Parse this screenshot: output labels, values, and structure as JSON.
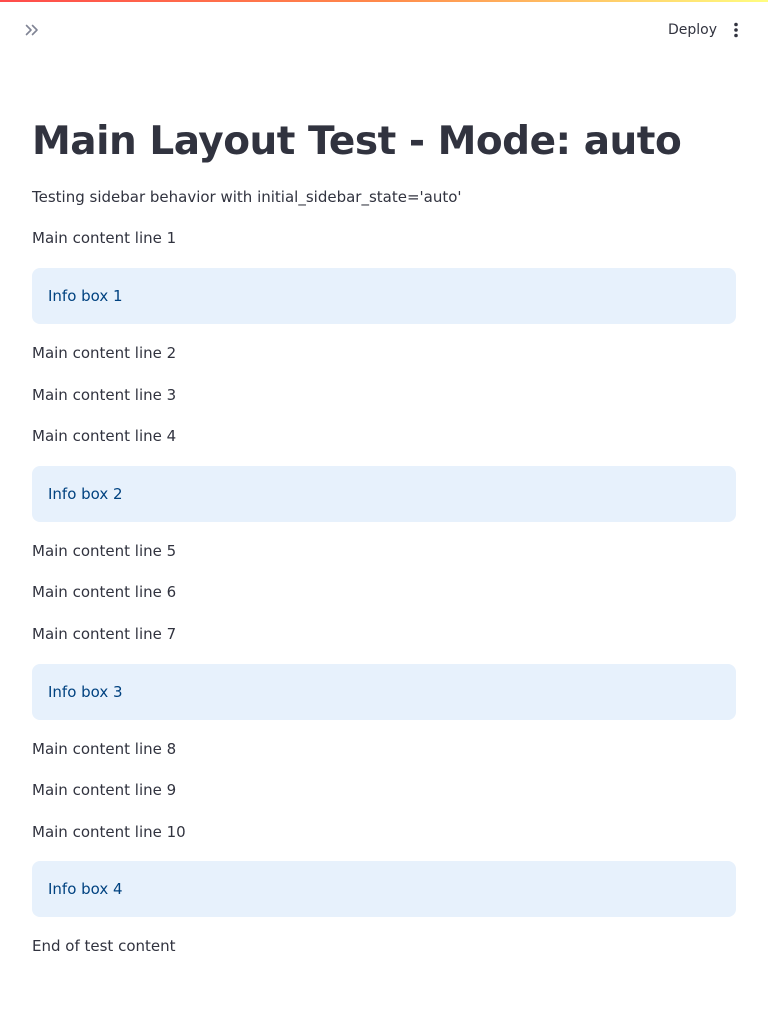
{
  "header": {
    "deploy_label": "Deploy",
    "expand_icon": "double-chevron-right-icon",
    "menu_icon": "vertical-ellipsis-icon"
  },
  "main": {
    "title": "Main Layout Test - Mode: auto",
    "subtitle": "Testing sidebar behavior with initial_sidebar_state='auto'",
    "lines": [
      "Main content line 1",
      "Main content line 2",
      "Main content line 3",
      "Main content line 4",
      "Main content line 5",
      "Main content line 6",
      "Main content line 7",
      "Main content line 8",
      "Main content line 9",
      "Main content line 10"
    ],
    "info_boxes": [
      "Info box 1",
      "Info box 2",
      "Info box 3",
      "Info box 4"
    ],
    "footer_text": "End of test content"
  },
  "colors": {
    "accent": "#ff4b4b",
    "info_bg": "#e7f1fc",
    "info_text": "#004280",
    "text": "#31333f"
  }
}
